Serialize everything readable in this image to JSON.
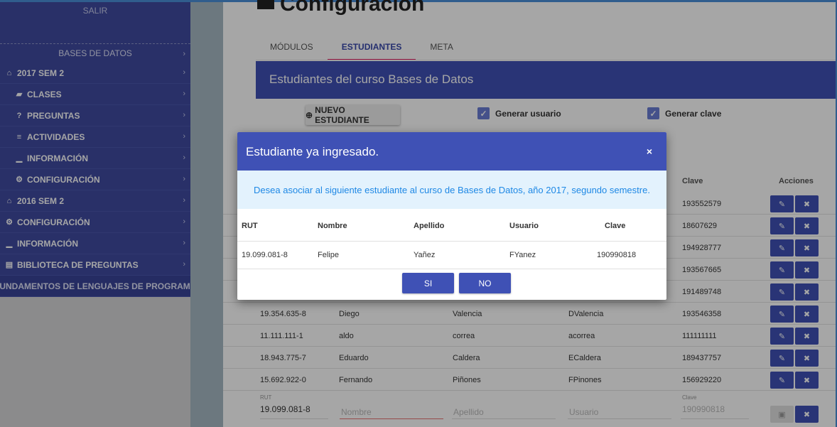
{
  "sidebar": {
    "salir": "SALIR",
    "items": [
      {
        "label": "BASES DE DATOS",
        "icon": "none"
      },
      {
        "label": "2017 SEM 2",
        "icon": "graduation-cap-icon"
      },
      {
        "label": "CLASES",
        "icon": "book-icon"
      },
      {
        "label": "PREGUNTAS",
        "icon": "question-icon"
      },
      {
        "label": "ACTIVIDADES",
        "icon": "list-icon"
      },
      {
        "label": "INFORMACIÓN",
        "icon": "bar-chart-icon"
      },
      {
        "label": "CONFIGURACIÓN",
        "icon": "gears-icon"
      },
      {
        "label": "2016 SEM 2",
        "icon": "graduation-cap-icon"
      },
      {
        "label": "CONFIGURACIÓN",
        "icon": "gears-icon"
      },
      {
        "label": "INFORMACIÓN",
        "icon": "bar-chart-icon"
      },
      {
        "label": "BIBLIOTECA DE PREGUNTAS",
        "icon": "archive-icon"
      },
      {
        "label": "FUNDAMENTOS DE LENGUAJES DE PROGRAMACIÓN",
        "icon": "none"
      }
    ]
  },
  "page": {
    "title": "Configuración",
    "tabs": [
      "MÓDULOS",
      "ESTUDIANTES",
      "META"
    ],
    "banner": "Estudiantes del curso Bases de Datos",
    "new_student_button": "NUEVO ESTUDIANTE",
    "generate_user": "Generar usuario",
    "generate_key": "Generar clave"
  },
  "table": {
    "headers": {
      "clave": "Clave",
      "acciones": "Acciones"
    },
    "partial_rows": [
      {
        "clave": "193552579"
      },
      {
        "clave": "18607629"
      },
      {
        "clave": "194928777"
      },
      {
        "clave": "193567665"
      },
      {
        "clave": "191489748"
      }
    ],
    "rows": [
      {
        "rut": "19.354.635-8",
        "nombre": "Diego",
        "apellido": "Valencia",
        "usuario": "DValencia",
        "clave": "193546358"
      },
      {
        "rut": "11.111.111-1",
        "nombre": "aldo",
        "apellido": "correa",
        "usuario": "acorrea",
        "clave": "111111111"
      },
      {
        "rut": "18.943.775-7",
        "nombre": "Eduardo",
        "apellido": "Caldera",
        "usuario": "ECaldera",
        "clave": "189437757"
      },
      {
        "rut": "15.692.922-0",
        "nombre": "Fernando",
        "apellido": "Piñones",
        "usuario": "FPinones",
        "clave": "156929220"
      }
    ],
    "new_row": {
      "rut_label": "RUT",
      "rut_value": "19.099.081-8",
      "nombre_placeholder": "Nombre",
      "apellido_placeholder": "Apellido",
      "usuario_placeholder": "Usuario",
      "clave_label": "Clave",
      "clave_value": "190990818"
    }
  },
  "modal": {
    "title": "Estudiante ya ingresado.",
    "close": "×",
    "message": "Desea asociar al siguiente estudiante al curso de Bases de Datos, año 2017, segundo semestre.",
    "headers": [
      "RUT",
      "Nombre",
      "Apellido",
      "Usuario",
      "Clave"
    ],
    "student": [
      "19.099.081-8",
      "Felipe",
      "Yañez",
      "FYanez",
      "190990818"
    ],
    "yes": "SI",
    "no": "NO"
  },
  "colors": {
    "primary": "#3f51b5",
    "sidebar": "#3f4aa0",
    "tab_indicator": "#e91e63",
    "alert_bg": "#e3f2fd",
    "alert_text": "#1e88e5"
  }
}
